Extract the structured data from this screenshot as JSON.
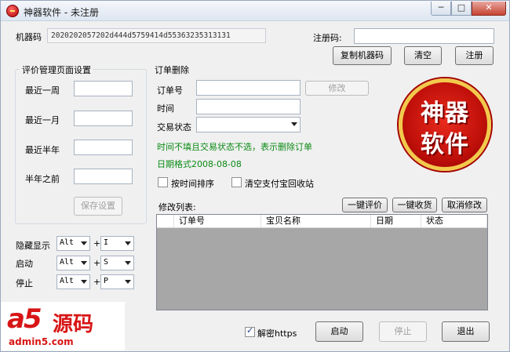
{
  "window": {
    "title": "神器软件 - 未注册",
    "min": "─",
    "max": "□",
    "close": "✕"
  },
  "machine": {
    "label": "机器码",
    "code": "2020202057202d444d5759414d55363235313131"
  },
  "register": {
    "label": "注册码:",
    "value": "",
    "copy_button": "复制机器码",
    "clear_button": "清空",
    "register_button": "注册"
  },
  "eval_group": {
    "title": "评价管理页面设置",
    "rows": [
      {
        "label": "最近一周",
        "value": ""
      },
      {
        "label": "最近一月",
        "value": ""
      },
      {
        "label": "最近半年",
        "value": ""
      },
      {
        "label": "半年之前",
        "value": ""
      }
    ],
    "save_button": "保存设置"
  },
  "hotkeys": [
    {
      "label": "隐藏显示",
      "mod": "Alt",
      "key": "I"
    },
    {
      "label": "启动",
      "mod": "Alt",
      "key": "S"
    },
    {
      "label": "停止",
      "mod": "Alt",
      "key": "P"
    }
  ],
  "plus": "+",
  "order_delete": {
    "title": "订单删除",
    "order_label": "订单号",
    "order_value": "",
    "modify_button": "修改",
    "time_label": "时间",
    "time_value": "",
    "status_label": "交易状态",
    "status_value": "",
    "hint": "时间不填且交易状态不选，表示删除订单",
    "date_format": "日期格式2008-08-08",
    "sort_by_time": {
      "label": "按时间排序",
      "checked": false
    },
    "clear_alipay": {
      "label": "清空支付宝回收站",
      "checked": false
    }
  },
  "logo": {
    "line1": "神器",
    "line2": "软件"
  },
  "modify_list": {
    "label": "修改列表:",
    "one_click_review": "一键评价",
    "one_click_receive": "一键收货",
    "cancel_modify": "取消修改",
    "columns": [
      "",
      "订单号",
      "宝贝名称",
      "日期",
      "状态"
    ]
  },
  "bottom": {
    "decrypt_https": {
      "label": "解密https",
      "checked": true
    },
    "start_button": "启动",
    "stop_button": "停止",
    "exit_button": "退出"
  },
  "watermark": {
    "brand": "a5",
    "cn": "源码",
    "url": "admin5.com"
  },
  "colors": {
    "hint_green": "#0a8a14",
    "logo_red": "#c0100a",
    "logo_gold": "#f2c94c"
  }
}
